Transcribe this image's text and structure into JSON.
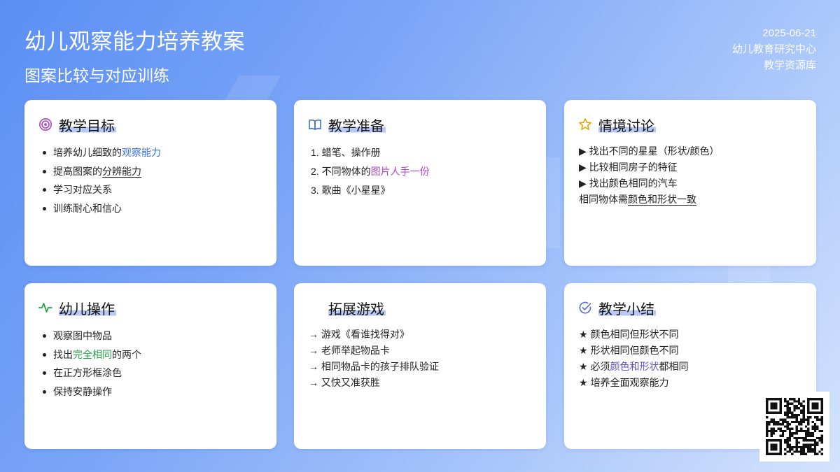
{
  "header": {
    "title": "幼儿观察能力培养教案",
    "subtitle": "图案比较与对应训练",
    "date": "2025-06-21",
    "org": "幼儿教育研究中心",
    "library": "教学资源库"
  },
  "cards": {
    "goals": {
      "title": "教学目标",
      "icon": "target-icon",
      "items": [
        {
          "pre": "培养幼儿细致的",
          "hl": "观察能力",
          "post": ""
        },
        {
          "pre": "提高图案的",
          "hl": "分辨能力",
          "post": ""
        },
        {
          "pre": "学习对应关系",
          "hl": "",
          "post": ""
        },
        {
          "pre": "训练耐心和信心",
          "hl": "",
          "post": ""
        }
      ]
    },
    "prep": {
      "title": "教学准备",
      "icon": "book-icon",
      "items": [
        {
          "pre": "1. 蜡笔、操作册",
          "hl": "",
          "post": ""
        },
        {
          "pre": "2. 不同物体的",
          "hl": "图片人手一份",
          "post": ""
        },
        {
          "pre": "3. 歌曲《小星星》",
          "hl": "",
          "post": ""
        }
      ]
    },
    "discussion": {
      "title": "情境讨论",
      "icon": "star-icon",
      "items": [
        {
          "pre": "▶ 找出不同的星星（形状/颜色）",
          "hl": "",
          "post": ""
        },
        {
          "pre": "▶ 比较相同房子的特征",
          "hl": "",
          "post": ""
        },
        {
          "pre": "▶ 找出颜色相同的汽车",
          "hl": "",
          "post": ""
        },
        {
          "pre": "相同物体需",
          "hl": "颜色和形状一致",
          "post": ""
        }
      ]
    },
    "operation": {
      "title": "幼儿操作",
      "icon": "activity-icon",
      "items": [
        {
          "pre": "观察图中物品",
          "hl": "",
          "post": ""
        },
        {
          "pre": "找出",
          "hl": "完全相同",
          "post": "的两个"
        },
        {
          "pre": "在正方形框涂色",
          "hl": "",
          "post": ""
        },
        {
          "pre": "保持安静操作",
          "hl": "",
          "post": ""
        }
      ]
    },
    "games": {
      "title": "拓展游戏",
      "items": [
        {
          "pre": "→ 游戏《看谁找得对》",
          "hl": "",
          "post": ""
        },
        {
          "pre": "→ 老师举起物品卡",
          "hl": "",
          "post": ""
        },
        {
          "pre": "→ 相同物品卡的孩子排队验证",
          "hl": "",
          "post": ""
        },
        {
          "pre": "→ 又快又准获胜",
          "hl": "",
          "post": ""
        }
      ]
    },
    "summary": {
      "title": "教学小结",
      "icon": "check-circle-icon",
      "items": [
        {
          "pre": "★ 颜色相同但形状不同",
          "hl": "",
          "post": ""
        },
        {
          "pre": "★ 形状相同但颜色不同",
          "hl": "",
          "post": ""
        },
        {
          "pre": "★ 必须",
          "hl": "颜色和形状",
          "post": "都相同"
        },
        {
          "pre": "★ 培养全面观察能力",
          "hl": "",
          "post": ""
        }
      ]
    }
  },
  "colors": {
    "accent_blue": "#3b6fd8",
    "accent_purple": "#b042c9",
    "accent_green": "#22a34a",
    "accent_indigo": "#5b4fd6",
    "star_gold": "#e0a800"
  }
}
